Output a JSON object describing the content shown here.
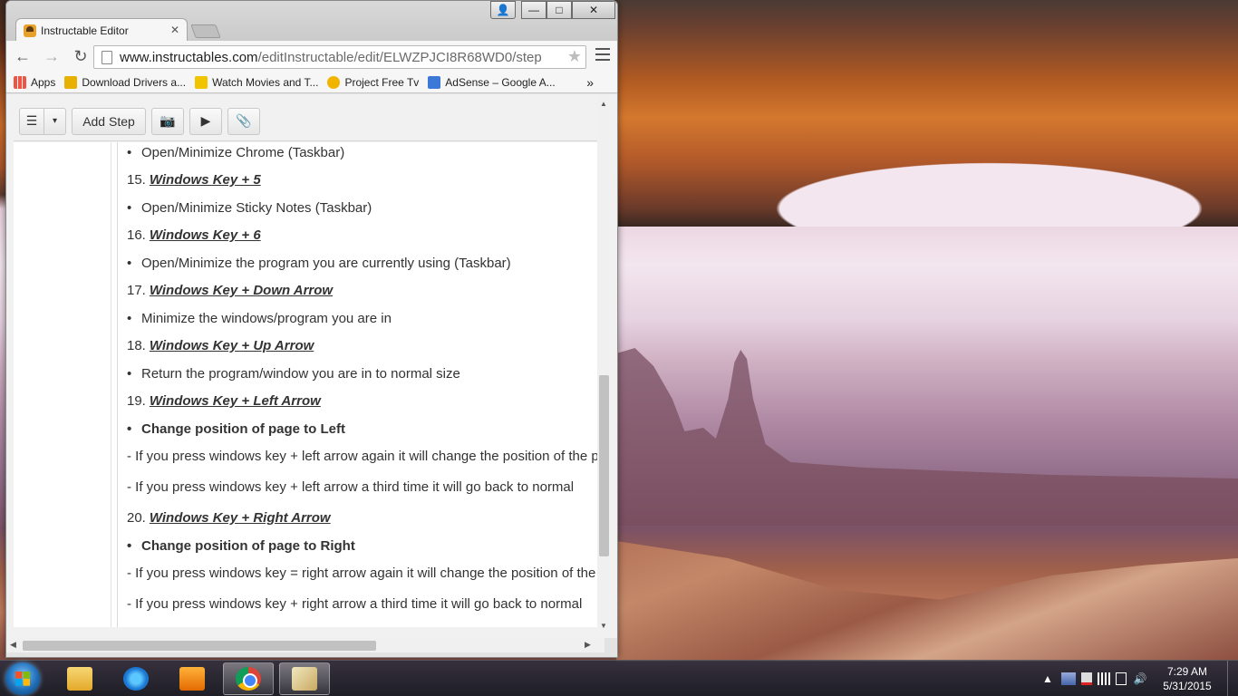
{
  "window": {
    "tab_title": "Instructable Editor",
    "tab_close": "✕",
    "url_host": "www.instructables.com",
    "url_path": "/editInstructable/edit/ELWZPJCI8R68WD0/step",
    "controls": {
      "user": "👤",
      "minimize": "—",
      "maximize": "□",
      "close": "✕"
    }
  },
  "nav": {
    "back": "←",
    "forward": "→",
    "reload": "↻",
    "star": "★"
  },
  "bookmarks": [
    {
      "label": "Apps"
    },
    {
      "label": "Download Drivers a..."
    },
    {
      "label": "Watch Movies and T..."
    },
    {
      "label": "Project Free Tv"
    },
    {
      "label": "AdSense – Google A..."
    }
  ],
  "bookmarks_more": "»",
  "editor": {
    "list_icon": "☰",
    "dropdown_icon": "▾",
    "add_step_label": "Add Step",
    "camera_icon": "📷",
    "video_icon": "▶",
    "attach_icon": "📎"
  },
  "content": {
    "l0": "Open/Minimize Chrome (Taskbar)",
    "n15": "15.",
    "k15": "Windows Key + 5",
    "l15": "Open/Minimize Sticky Notes (Taskbar)",
    "n16": "16.",
    "k16": "Windows Key + 6",
    "l16": "Open/Minimize the program you are currently using (Taskbar)",
    "n17": "17.",
    "k17": "Windows Key + Down Arrow",
    "l17": "Minimize the windows/program you are in",
    "n18": "18.",
    "k18": "Windows Key + Up Arrow",
    "l18": "Return the program/window you are in to normal size",
    "n19": "19.",
    "k19": "Windows Key + Left Arrow",
    "l19": "Change position of page to Left",
    "d19a": "- If you press windows key + left arrow again it will change the position of the pag",
    "d19b": "- If you press windows key + left arrow a third time it will go back to normal",
    "n20": "20.",
    "k20": "Windows Key + Right Arrow",
    "l20": "Change position of page to Right",
    "d20a": "- If you press windows key = right arrow again it will change the position of the pa",
    "d20b": "- If you press windows key + right arrow a third time it will go back to normal"
  },
  "taskbar": {
    "time": "7:29 AM",
    "date": "5/31/2015",
    "tray_up": "▲",
    "volume": "🔊"
  }
}
